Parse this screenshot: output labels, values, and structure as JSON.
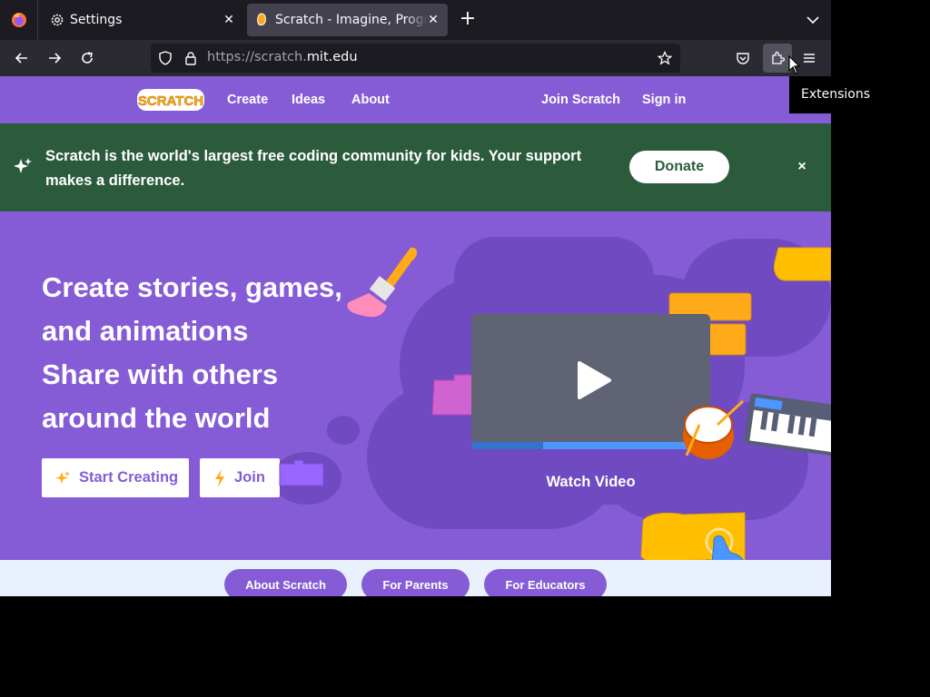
{
  "browser": {
    "tabs": [
      {
        "title": "Settings",
        "icon": "gear-icon",
        "active": false
      },
      {
        "title": "Scratch - Imagine, Program, Share",
        "icon": "scratch-favicon",
        "active": true
      }
    ],
    "url": {
      "prefix": "https://scratch.",
      "domain": "mit.edu"
    },
    "tooltip": "Extensions"
  },
  "scratch_nav": {
    "logo": "Scratch",
    "links": [
      "Create",
      "Ideas",
      "About"
    ],
    "join": "Join Scratch",
    "sign_in": "Sign in"
  },
  "banner": {
    "text": "Scratch is the world's largest free coding community for kids. Your support makes a difference.",
    "donate": "Donate",
    "close": "×",
    "color": "#2b5b3b"
  },
  "hero": {
    "lines": [
      "Create stories, games,",
      "and animations",
      "Share with others",
      "around the world"
    ],
    "start_creating": "Start Creating",
    "join": "Join",
    "watch_video": "Watch Video",
    "video_progress": 0.3
  },
  "lower": {
    "pills": [
      "About Scratch",
      "For Parents",
      "For Educators"
    ]
  },
  "colors": {
    "scratch_purple": "#855cd6",
    "dark_purple": "#6f4ac0",
    "scratch_orange": "#ffab19",
    "firefox_toolbar": "#2b2a33"
  }
}
